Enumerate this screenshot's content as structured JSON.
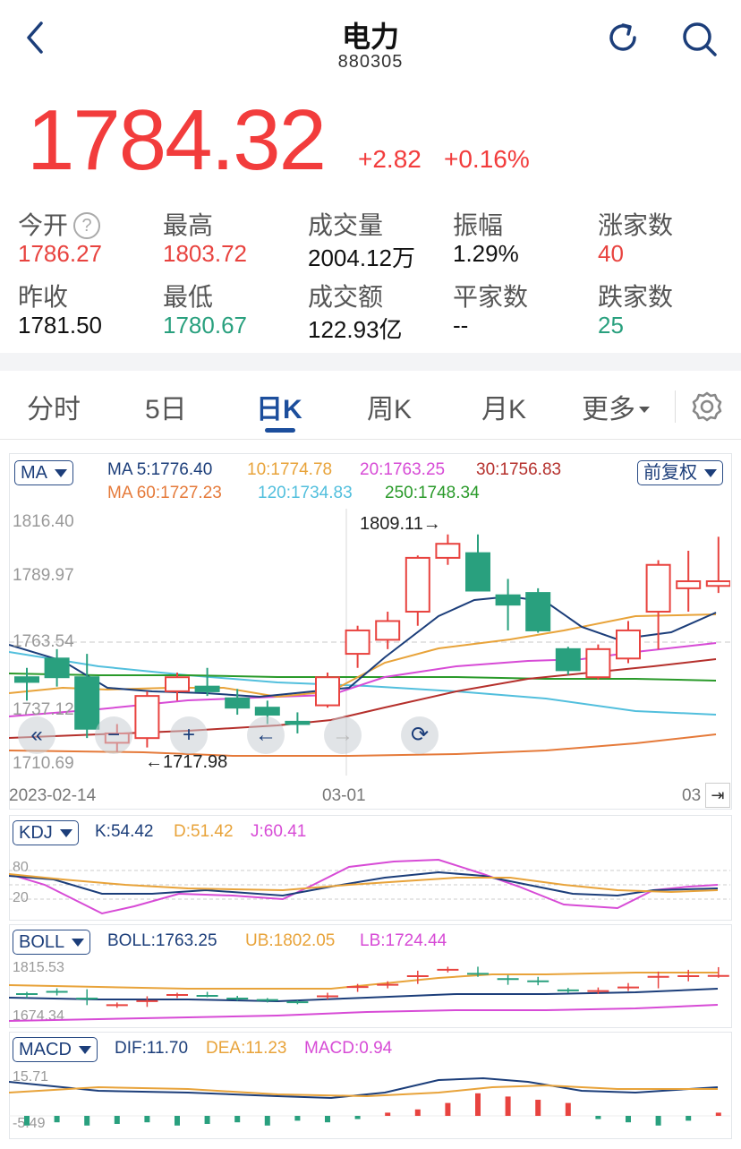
{
  "header": {
    "title": "电力",
    "code": "880305"
  },
  "quote": {
    "price": "1784.32",
    "change": "+2.82",
    "change_pct": "+0.16%"
  },
  "stats": {
    "open_label": "今开",
    "open": "1786.27",
    "high_label": "最高",
    "high": "1803.72",
    "volume_label": "成交量",
    "volume": "2004.12万",
    "amplitude_label": "振幅",
    "amplitude": "1.29%",
    "up_label": "涨家数",
    "up": "40",
    "prev_close_label": "昨收",
    "prev_close": "1781.50",
    "low_label": "最低",
    "low": "1780.67",
    "turnover_label": "成交额",
    "turnover": "122.93亿",
    "flat_label": "平家数",
    "flat": "--",
    "down_label": "跌家数",
    "down": "25"
  },
  "tabs": [
    "分时",
    "5日",
    "日K",
    "周K",
    "月K",
    "更多"
  ],
  "active_tab": "日K",
  "ma_panel": {
    "selector": "MA",
    "row1": {
      "ma5": "MA 5:1776.40",
      "ma10": "10:1774.78",
      "ma20": "20:1763.25",
      "ma30": "30:1756.83"
    },
    "row2": {
      "ma60": "MA 60:1727.23",
      "ma120": "120:1734.83",
      "ma250": "250:1748.34"
    },
    "adjust": "前复权",
    "yticks": [
      "1816.40",
      "1789.97",
      "1763.54",
      "1737.12",
      "1710.69"
    ],
    "max_label": "1809.11→",
    "min_label": "←1717.98",
    "dates": [
      "2023-02-14",
      "03-01",
      "03"
    ]
  },
  "kdj": {
    "selector": "KDJ",
    "k": "K:54.42",
    "d": "D:51.42",
    "j": "J:60.41",
    "yticks": [
      "80",
      "20"
    ]
  },
  "boll": {
    "selector": "BOLL",
    "boll": "BOLL:1763.25",
    "ub": "UB:1802.05",
    "lb": "LB:1724.44",
    "yticks": [
      "1815.53",
      "1674.34"
    ]
  },
  "macd": {
    "selector": "MACD",
    "dif": "DIF:11.70",
    "dea": "DEA:11.23",
    "macd": "MACD:0.94",
    "yticks": [
      "15.71",
      "-5.49"
    ]
  },
  "colors": {
    "up": "#e8433f",
    "down": "#29a07e",
    "accent": "#1c4e9c",
    "price": "#f23c3c"
  },
  "candles": [
    {
      "o": 1748,
      "h": 1752,
      "l": 1738,
      "c": 1746
    },
    {
      "o": 1756,
      "h": 1760,
      "l": 1744,
      "c": 1748
    },
    {
      "o": 1748,
      "h": 1758,
      "l": 1722,
      "c": 1726
    },
    {
      "o": 1720,
      "h": 1728,
      "l": 1716,
      "c": 1724
    },
    {
      "o": 1722,
      "h": 1742,
      "l": 1718,
      "c": 1740
    },
    {
      "o": 1742,
      "h": 1750,
      "l": 1738,
      "c": 1748
    },
    {
      "o": 1744,
      "h": 1752,
      "l": 1740,
      "c": 1742
    },
    {
      "o": 1739,
      "h": 1743,
      "l": 1732,
      "c": 1735
    },
    {
      "o": 1735,
      "h": 1738,
      "l": 1728,
      "c": 1732
    },
    {
      "o": 1729,
      "h": 1733,
      "l": 1724,
      "c": 1728
    },
    {
      "o": 1736,
      "h": 1750,
      "l": 1735,
      "c": 1748
    },
    {
      "o": 1758,
      "h": 1770,
      "l": 1752,
      "c": 1768
    },
    {
      "o": 1764,
      "h": 1776,
      "l": 1760,
      "c": 1772
    },
    {
      "o": 1776,
      "h": 1800,
      "l": 1770,
      "c": 1799
    },
    {
      "o": 1799,
      "h": 1809,
      "l": 1796,
      "c": 1805
    },
    {
      "o": 1801,
      "h": 1809,
      "l": 1786,
      "c": 1785
    },
    {
      "o": 1783,
      "h": 1790,
      "l": 1768,
      "c": 1779
    },
    {
      "o": 1784,
      "h": 1786,
      "l": 1767,
      "c": 1768
    },
    {
      "o": 1760,
      "h": 1761,
      "l": 1749,
      "c": 1751
    },
    {
      "o": 1748,
      "h": 1762,
      "l": 1747,
      "c": 1760
    },
    {
      "o": 1756,
      "h": 1772,
      "l": 1754,
      "c": 1768
    },
    {
      "o": 1776,
      "h": 1798,
      "l": 1760,
      "c": 1796
    },
    {
      "o": 1786,
      "h": 1802,
      "l": 1776,
      "c": 1789
    },
    {
      "o": 1787,
      "h": 1808,
      "l": 1784,
      "c": 1789
    }
  ]
}
